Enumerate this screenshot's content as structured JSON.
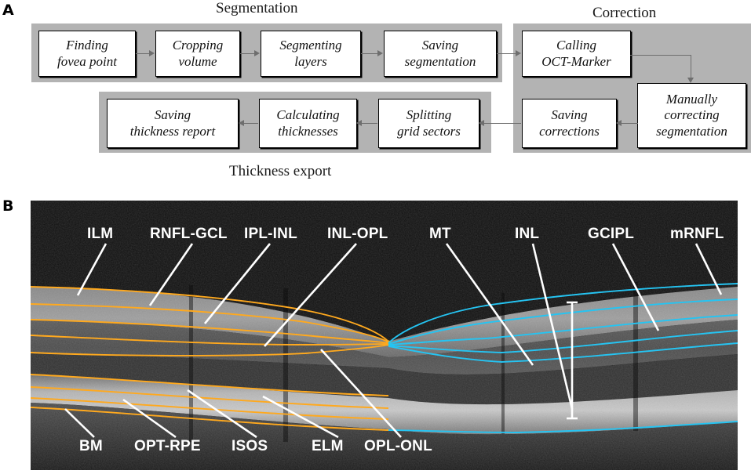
{
  "figure": {
    "panel_a_letter": "A",
    "panel_b_letter": "B"
  },
  "flowchart": {
    "groups": [
      {
        "title": "Segmentation"
      },
      {
        "title": "Correction"
      },
      {
        "title": "Thickness export"
      }
    ],
    "nodes": {
      "finding_fovea": {
        "line1": "Finding",
        "line2": "fovea point"
      },
      "cropping": {
        "line1": "Cropping",
        "line2": "volume"
      },
      "segmenting": {
        "line1": "Segmenting",
        "line2": "layers"
      },
      "saving_segmentation": {
        "line1": "Saving",
        "line2": "segmentation"
      },
      "calling_marker": {
        "line1": "Calling",
        "line2": "OCT-Marker"
      },
      "manually_correcting": {
        "line1": "Manually",
        "line2": "correcting",
        "line3": "segmentation"
      },
      "saving_corrections": {
        "line1": "Saving",
        "line2": "corrections"
      },
      "splitting": {
        "line1": "Splitting",
        "line2": "grid sectors"
      },
      "calculating": {
        "line1": "Calculating",
        "line2": "thicknesses"
      },
      "saving_report": {
        "line1": "Saving",
        "line2": "thickness report"
      }
    }
  },
  "oct": {
    "labels_top_left": [
      "ILM",
      "RNFL-GCL",
      "IPL-INL",
      "INL-OPL"
    ],
    "labels_top_right": [
      "MT",
      "INL",
      "GCIPL",
      "mRNFL"
    ],
    "labels_bottom": [
      "BM",
      "OPT-RPE",
      "ISOS",
      "ELM",
      "OPL-ONL"
    ],
    "label_ilm": "ILM",
    "label_rnfl_gcl": "RNFL-GCL",
    "label_ipl_inl": "IPL-INL",
    "label_inl_opl": "INL-OPL",
    "label_mt": "MT",
    "label_inl": "INL",
    "label_gcipl": "GCIPL",
    "label_mrnfl": "mRNFL",
    "label_bm": "BM",
    "label_opt_rpe": "OPT-RPE",
    "label_isos": "ISOS",
    "label_elm": "ELM",
    "label_opl_onl": "OPL-ONL",
    "colors": {
      "segmentation_line_left": "#FFA91E",
      "segmentation_line_right": "#25C4F2",
      "leader_line": "#FFFFFF",
      "background": "#0A0A0A"
    }
  }
}
